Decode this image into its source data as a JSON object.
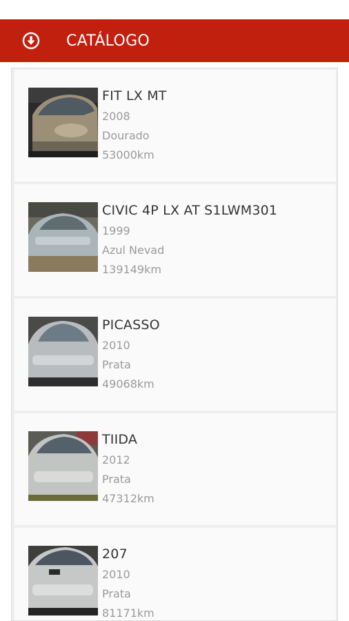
{
  "header": {
    "title": "CATÁLOGO",
    "menu_icon": "circle-arrow-down-icon",
    "bar_color": "#c2200e"
  },
  "cars": [
    {
      "model": "FIT LX MT",
      "year": "2008",
      "color": "Dourado",
      "mileage": "53000km",
      "photo": "car-photo"
    },
    {
      "model": "CIVIC 4P LX AT S1LWM301",
      "year": "1999",
      "color": "Azul Nevad",
      "mileage": "139149km",
      "photo": "car-photo"
    },
    {
      "model": "PICASSO",
      "year": "2010",
      "color": "Prata",
      "mileage": "49068km",
      "photo": "car-photo"
    },
    {
      "model": "TIIDA",
      "year": "2012",
      "color": "Prata",
      "mileage": "47312km",
      "photo": "car-photo"
    },
    {
      "model": "207",
      "year": "2010",
      "color": "Prata",
      "mileage": "81171km",
      "photo": "car-photo"
    }
  ]
}
